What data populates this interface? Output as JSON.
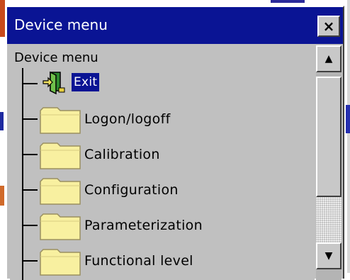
{
  "dialog": {
    "title": "Device menu",
    "close_label": "×"
  },
  "tree": {
    "root_label": "Device menu",
    "items": [
      {
        "label": "Exit",
        "icon": "exit-door-icon",
        "selected": true
      },
      {
        "label": "Logon/logoff",
        "icon": "folder-icon"
      },
      {
        "label": "Calibration",
        "icon": "folder-icon"
      },
      {
        "label": "Configuration",
        "icon": "folder-icon"
      },
      {
        "label": "Parameterization",
        "icon": "folder-icon"
      },
      {
        "label": "Functional level",
        "icon": "folder-icon"
      }
    ]
  },
  "scrollbar": {
    "up_label": "▲",
    "down_label": "▼"
  },
  "colors": {
    "titlebar": "#0a1494",
    "selection": "#0a1494",
    "panel": "#c0c0c0",
    "folder": "#f8f0a0"
  }
}
